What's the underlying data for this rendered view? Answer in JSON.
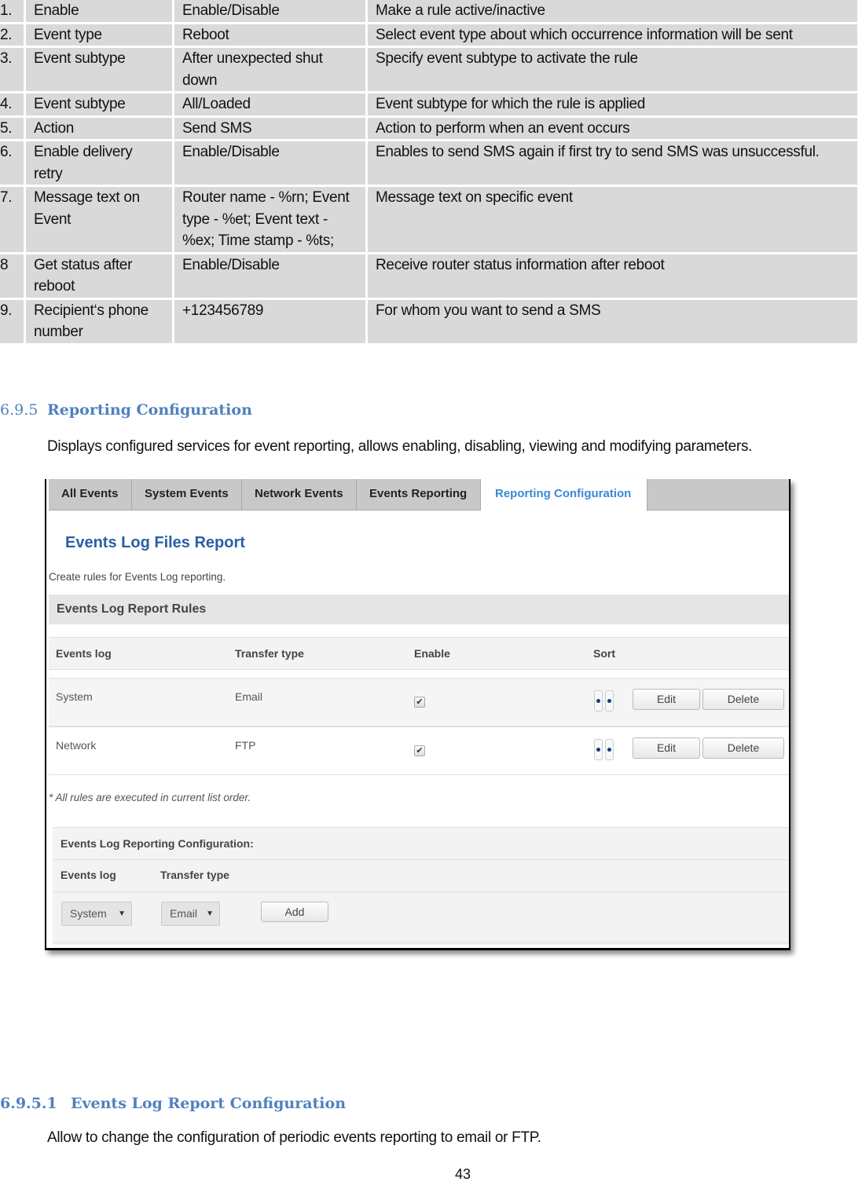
{
  "param_table": {
    "rows": [
      {
        "num": "1.",
        "name": "Enable",
        "value": "Enable/Disable",
        "desc": "Make a rule active/inactive"
      },
      {
        "num": "2.",
        "name": "Event type",
        "value": "Reboot",
        "desc": "Select event type about which occurrence information will be sent"
      },
      {
        "num": "3.",
        "name": "Event subtype",
        "value": "After unexpected shut down",
        "desc": "Specify event subtype to activate the rule"
      },
      {
        "num": "4.",
        "name": "Event subtype",
        "value": "All/Loaded",
        "desc": "Event subtype for which the rule is applied"
      },
      {
        "num": "5.",
        "name": "Action",
        "value": "Send SMS",
        "desc": "Action to perform when an event occurs"
      },
      {
        "num": "6.",
        "name": "Enable delivery retry",
        "value": "Enable/Disable",
        "desc": "Enables to send SMS again if first try to send SMS was unsuccessful."
      },
      {
        "num": "7.",
        "name": "Message text  on Event",
        "value": "Router name - %rn; Event type - %et; Event text - %ex; Time stamp - %ts;",
        "desc": "Message text on specific event"
      },
      {
        "num": "8",
        "name": "Get status after reboot",
        "value": "Enable/Disable",
        "desc": "Receive router status information after reboot"
      },
      {
        "num": "9.",
        "name": "Recipient‘s phone number",
        "value": "+123456789",
        "desc": "For whom you want to send a SMS"
      }
    ]
  },
  "section": {
    "number": "6.9.5",
    "title": "Reporting Configuration",
    "intro": "Displays configured services for event reporting, allows enabling, disabling, viewing and modifying parameters."
  },
  "screenshot": {
    "tabs": [
      {
        "label": "All Events",
        "active": false
      },
      {
        "label": "System Events",
        "active": false
      },
      {
        "label": "Network Events",
        "active": false
      },
      {
        "label": "Events Reporting",
        "active": false
      },
      {
        "label": "Reporting Configuration",
        "active": true
      }
    ],
    "page_title": "Events Log Files Report",
    "page_desc": "Create rules for Events Log reporting.",
    "rules_section_title": "Events Log Report Rules",
    "rules_columns": [
      "Events log",
      "Transfer type",
      "Enable",
      "Sort"
    ],
    "rules": [
      {
        "events_log": "System",
        "transfer_type": "Email",
        "enabled": true,
        "edit_label": "Edit",
        "delete_label": "Delete"
      },
      {
        "events_log": "Network",
        "transfer_type": "FTP",
        "enabled": true,
        "edit_label": "Edit",
        "delete_label": "Delete"
      }
    ],
    "note": "* All rules are executed in current list order.",
    "config": {
      "title": "Events Log Reporting Configuration:",
      "col_events_log": "Events log",
      "col_transfer_type": "Transfer type",
      "events_log_selected": "System",
      "transfer_type_selected": "Email",
      "add_label": "Add"
    },
    "colors": {
      "active_tab": "#3a8ad6",
      "page_title": "#2a5fa6",
      "sort_arrow": "#153a7a"
    }
  },
  "subsection": {
    "number": "6.9.5.1",
    "title": "Events Log Report Configuration",
    "intro": "Allow to change the configuration of periodic events reporting to email or FTP."
  },
  "page_number": "43",
  "colors": {
    "heading": "#4f81bd",
    "table_cell_bg": "#d9d9d9"
  }
}
